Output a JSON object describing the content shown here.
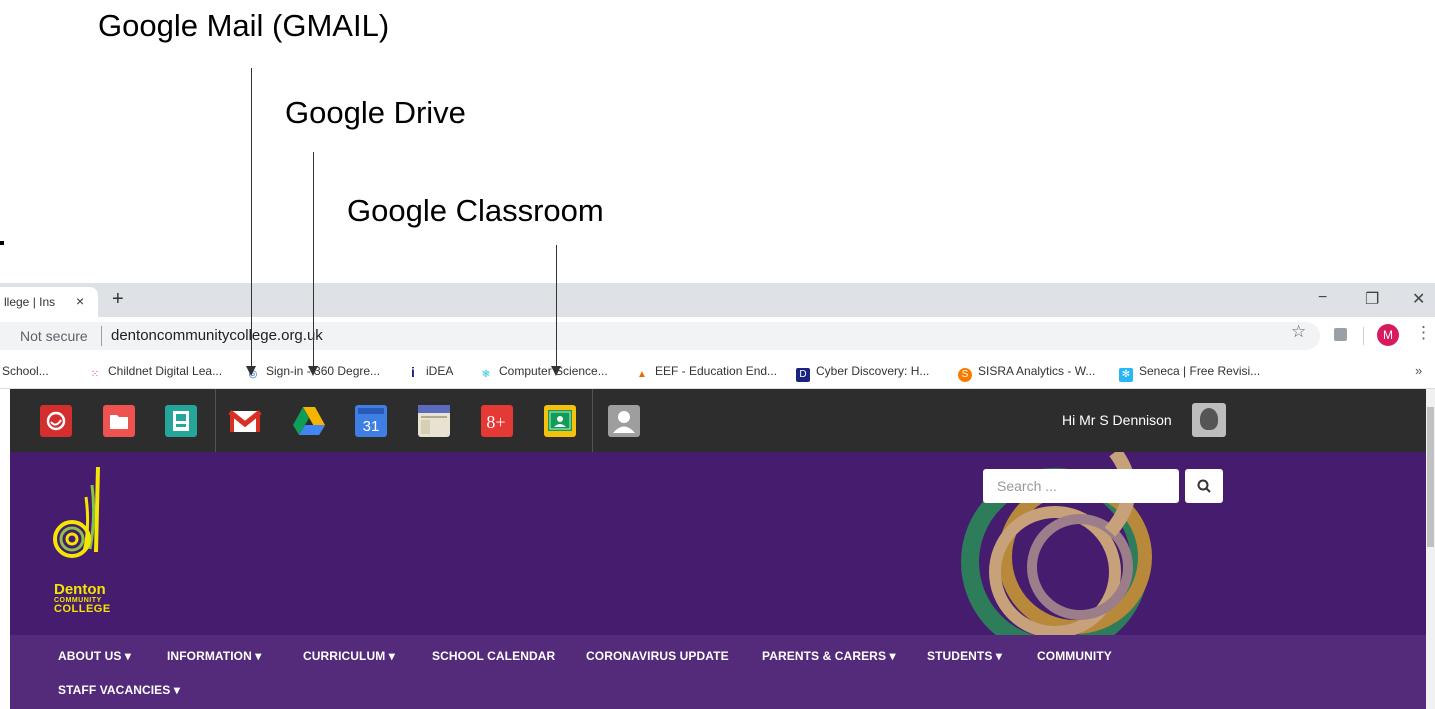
{
  "annotations": {
    "gmail": "Google Mail (GMAIL)",
    "drive": "Google Drive",
    "classroom": "Google Classroom"
  },
  "browser": {
    "tab_title": "llege | Ins",
    "tab_close": "×",
    "new_tab": "+",
    "security": "Not secure",
    "url": "dentoncommunitycollege.org.uk",
    "profile_initial": "M",
    "window_controls": [
      "−",
      "❐",
      "✕"
    ],
    "bookmarks": [
      {
        "label": "School...",
        "icon": "none"
      },
      {
        "label": "Childnet Digital Lea...",
        "icon": "grid-icon",
        "color": "#e53935"
      },
      {
        "label": "Sign-in - 360 Degre...",
        "icon": "swirl-icon",
        "color": "#1565c0"
      },
      {
        "label": "iDEA",
        "icon": "info-icon",
        "color": "#1a237e"
      },
      {
        "label": "Computer Science...",
        "icon": "brain-icon",
        "color": "#4dd0e1"
      },
      {
        "label": "EEF - Education End...",
        "icon": "triangle-icon",
        "color": "#ef6c00"
      },
      {
        "label": "Cyber Discovery: H...",
        "icon": "d-icon",
        "color": "#1a237e"
      },
      {
        "label": "SISRA Analytics - W...",
        "icon": "s-icon",
        "color": "#f57c00"
      },
      {
        "label": "Seneca | Free Revisi...",
        "icon": "snowflake-icon",
        "color": "#29b6f6"
      }
    ],
    "bookmarks_more": "»"
  },
  "site": {
    "apps": [
      {
        "name": "app-swirl-icon",
        "color": "#d32f2f"
      },
      {
        "name": "folder-icon",
        "color": "#ef5350"
      },
      {
        "name": "sites-icon",
        "color": "#26a69a"
      },
      {
        "name": "gmail-icon",
        "color": "#ffffff"
      },
      {
        "name": "drive-icon",
        "color": "#ffffff"
      },
      {
        "name": "calendar-icon",
        "color": "#3f7fe3",
        "text": "31"
      },
      {
        "name": "browser-window-icon",
        "color": "#e8e3d0"
      },
      {
        "name": "google-plus-icon",
        "color": "#e53935",
        "text": "8+"
      },
      {
        "name": "classroom-icon",
        "color": "#f4c20d"
      },
      {
        "name": "user-icon",
        "color": "#9e9e9e"
      }
    ],
    "greeting": "Hi Mr S Dennison",
    "search_placeholder": "Search ...",
    "logo": {
      "line1": "Denton",
      "line2": "COMMUNITY",
      "line3": "COLLEGE"
    },
    "nav": [
      "ABOUT US ▾",
      "INFORMATION ▾",
      "CURRICULUM ▾",
      "SCHOOL CALENDAR",
      "CORONAVIRUS UPDATE",
      "PARENTS & CARERS ▾",
      "STUDENTS ▾",
      "COMMUNITY",
      "STAFF VACANCIES ▾"
    ],
    "colors": {
      "topbar": "#2d2d2d",
      "hero": "#461c6e",
      "nav": "#542b7b"
    }
  }
}
